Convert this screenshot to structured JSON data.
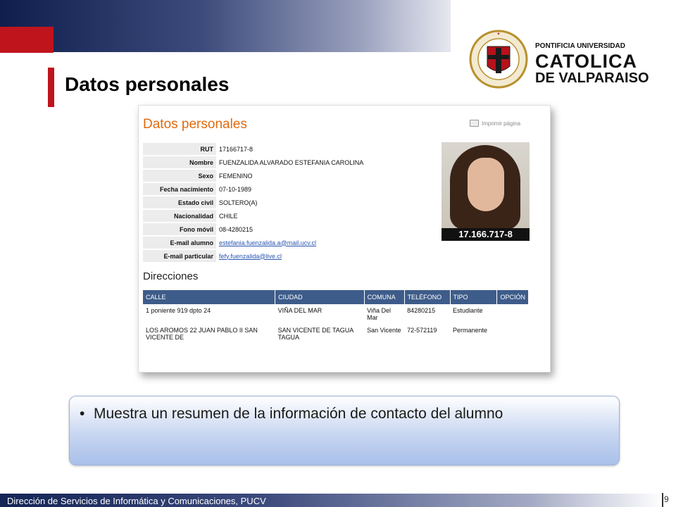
{
  "slide": {
    "title": "Datos personales",
    "bullet": "Muestra un resumen de la información de contacto del alumno",
    "footer": "Dirección de Servicios de Informática y Comunicaciones, PUCV",
    "page_number": "9"
  },
  "logo": {
    "line1": "PONTIFICIA UNIVERSIDAD",
    "line2": "CATOLICA",
    "line3": "DE VALPARAISO",
    "seal_text": "PONTIFICIA UNIVERSIDAD CATOLICA DE VALPARAISO"
  },
  "screenshot": {
    "title": "Datos personales",
    "print_label": "Imprimir página",
    "fields": [
      {
        "label": "RUT",
        "value": "17166717-8"
      },
      {
        "label": "Nombre",
        "value": "FUENZALIDA ALVARADO ESTEFANIA CAROLINA"
      },
      {
        "label": "Sexo",
        "value": "FEMENINO"
      },
      {
        "label": "Fecha nacimiento",
        "value": "07-10-1989"
      },
      {
        "label": "Estado civil",
        "value": "SOLTERO(A)"
      },
      {
        "label": "Nacionalidad",
        "value": "CHILE"
      },
      {
        "label": "Fono móvil",
        "value": "08-4280215"
      },
      {
        "label": "E-mail alumno",
        "value": "estefania.fuenzalida.a@mail.ucv.cl"
      },
      {
        "label": "E-mail particular",
        "value": "fefy.fuenzalida@live.cl"
      }
    ],
    "photo_caption": "17.166.717-8",
    "addresses_title": "Direcciones",
    "addr_headers": [
      "CALLE",
      "CIUDAD",
      "COMUNA",
      "TELÉFONO",
      "TIPO",
      "OPCIÓN"
    ],
    "addresses": [
      {
        "calle": "1 poniente 919 dpto 24",
        "ciudad": "VIÑA DEL MAR",
        "comuna": "Viña Del Mar",
        "telefono": "84280215",
        "tipo": "Estudiante",
        "opcion": ""
      },
      {
        "calle": "LOS AROMOS 22 JUAN PABLO II SAN VICENTE DE",
        "ciudad": "SAN VICENTE DE TAGUA TAGUA",
        "comuna": "San Vicente",
        "telefono": "72-572119",
        "tipo": "Permanente",
        "opcion": ""
      }
    ]
  },
  "colors": {
    "accent_red": "#c0141c",
    "navy": "#0f1e4d",
    "orange_title": "#e06a10",
    "table_header": "#3e5c8a"
  }
}
